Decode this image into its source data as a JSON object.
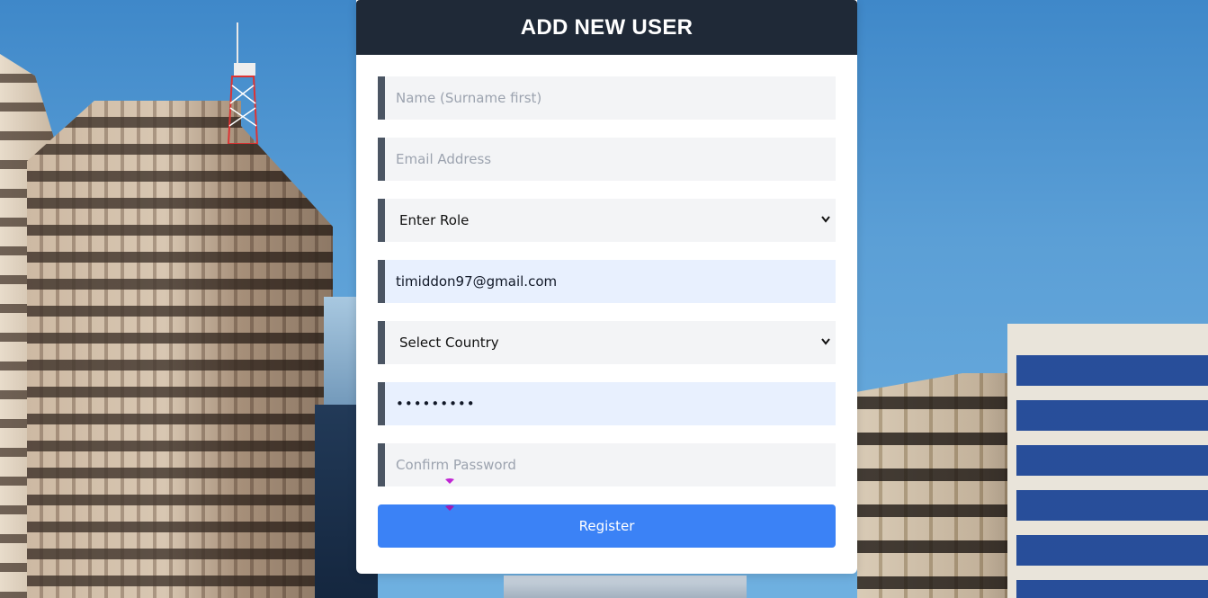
{
  "page": {
    "title": "ADD NEW USER"
  },
  "form": {
    "name": {
      "value": "",
      "placeholder": "Name (Surname first)"
    },
    "email": {
      "value": "",
      "placeholder": "Email Address"
    },
    "role": {
      "selected": "Enter Role",
      "options": [
        "Enter Role"
      ]
    },
    "username_email": {
      "value": "timiddon97@gmail.com",
      "placeholder": ""
    },
    "country": {
      "selected": "Select Country",
      "options": [
        "Select Country"
      ]
    },
    "password": {
      "value": "•••••••••",
      "placeholder": ""
    },
    "confirm_password": {
      "value": "",
      "placeholder": "Confirm Password"
    },
    "submit_label": "Register"
  },
  "colors": {
    "header_bg": "#1f2937",
    "field_bg": "#f3f4f6",
    "autofill_bg": "#e8f0fe",
    "field_accent": "#4b5563",
    "button_bg": "#3b82f6"
  },
  "icons": {
    "select_arrow": "chevron-down-icon",
    "cursor_overlay": "cursor-marker-icon"
  }
}
